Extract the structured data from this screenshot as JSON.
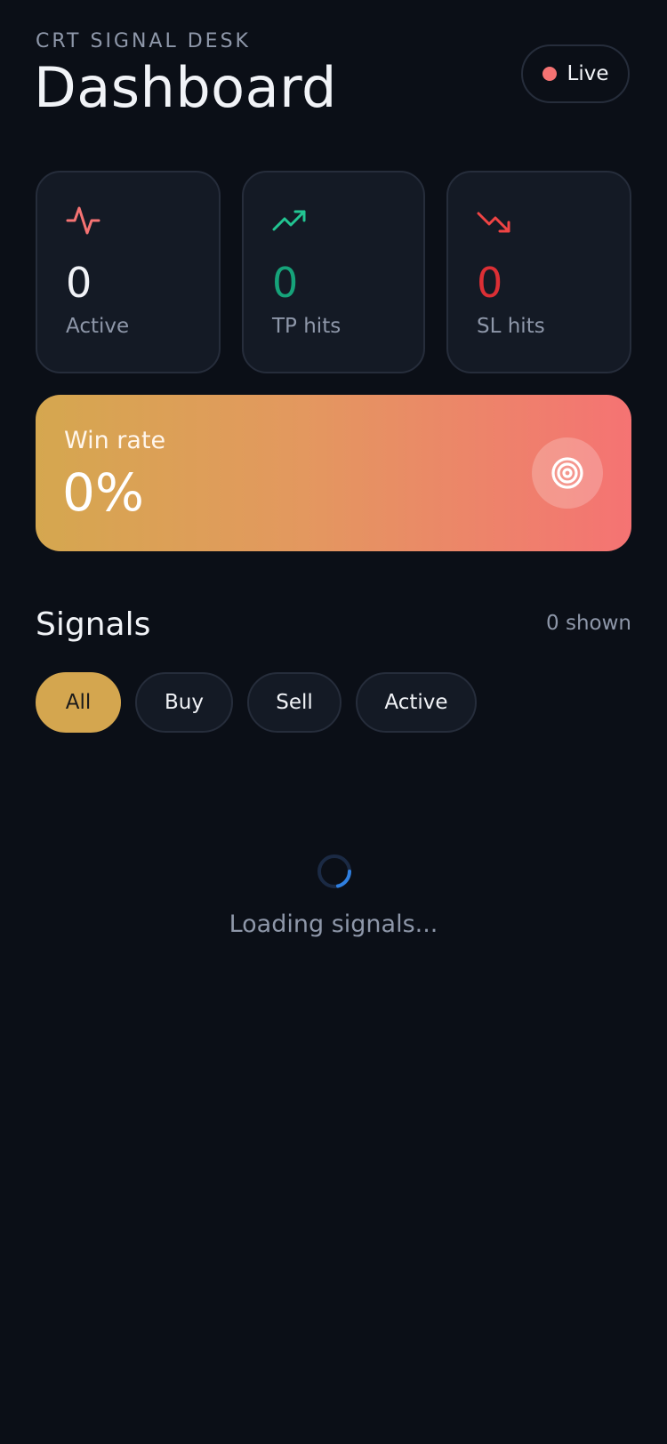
{
  "header": {
    "eyebrow": "CRT SIGNAL DESK",
    "title": "Dashboard",
    "status": {
      "label": "Live",
      "dot_color": "#f57373"
    }
  },
  "stats": [
    {
      "icon": "activity-icon",
      "value": "0",
      "label": "Active",
      "color": "#f1f3f7",
      "icon_color": "#f57373"
    },
    {
      "icon": "trending-up-icon",
      "value": "0",
      "label": "TP hits",
      "color": "#16a37a",
      "icon_color": "#22c592"
    },
    {
      "icon": "trending-down-icon",
      "value": "0",
      "label": "SL hits",
      "color": "#dc2f35",
      "icon_color": "#ef4444"
    }
  ],
  "winrate": {
    "label": "Win rate",
    "value": "0%",
    "icon": "target-icon",
    "gradient": [
      "#d5a74f",
      "#f57373"
    ]
  },
  "signals": {
    "title": "Signals",
    "count_text": "0 shown",
    "filters": [
      {
        "label": "All",
        "selected": true
      },
      {
        "label": "Buy",
        "selected": false
      },
      {
        "label": "Sell",
        "selected": false
      },
      {
        "label": "Active",
        "selected": false
      }
    ],
    "loading_text": "Loading signals..."
  },
  "colors": {
    "background": "#0b0f17",
    "card": "#141a25",
    "border": "#262d3b",
    "accent": "#d4a64f",
    "muted_text": "#8e97a9",
    "spinner": "#2f7fe0"
  }
}
